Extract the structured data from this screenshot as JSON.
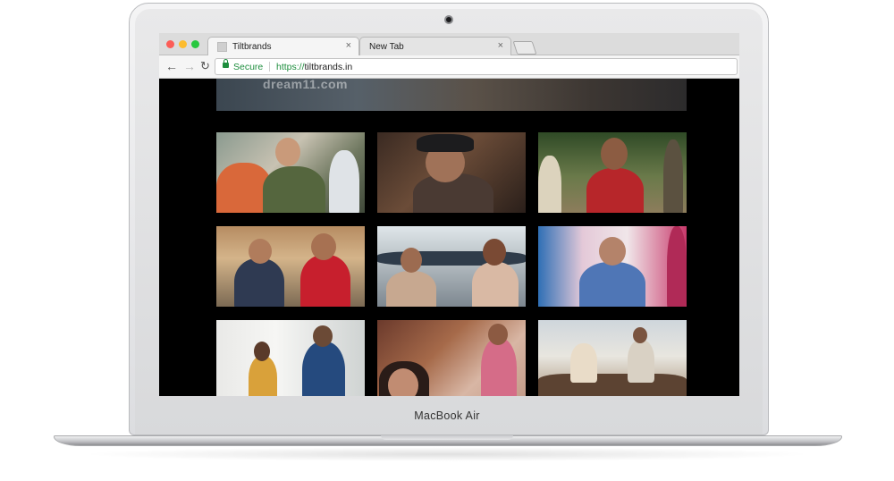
{
  "browser": {
    "tabs": [
      {
        "title": "Tiltbrands",
        "active": true,
        "close_glyph": "×"
      },
      {
        "title": "New Tab",
        "active": false,
        "close_glyph": "×"
      }
    ],
    "address": {
      "secure_label": "Secure",
      "scheme": "https://",
      "host": "tiltbrands.in"
    },
    "icons": [
      "back-arrow-icon",
      "forward-arrow-icon",
      "reload-icon",
      "lock-icon",
      "close-icon"
    ]
  },
  "page": {
    "banner_text": "dream11.com",
    "thumbnails": [
      {
        "id": "thumb-1"
      },
      {
        "id": "thumb-2"
      },
      {
        "id": "thumb-3"
      },
      {
        "id": "thumb-4"
      },
      {
        "id": "thumb-5"
      },
      {
        "id": "thumb-6"
      },
      {
        "id": "thumb-7"
      },
      {
        "id": "thumb-8"
      },
      {
        "id": "thumb-9"
      }
    ]
  },
  "device": {
    "label": "MacBook Air"
  },
  "colors": {
    "secure_green": "#1e8e3e",
    "page_background": "#000000",
    "traffic_red": "#fc5d57",
    "traffic_yellow": "#fdbc2e",
    "traffic_green": "#28c840"
  }
}
